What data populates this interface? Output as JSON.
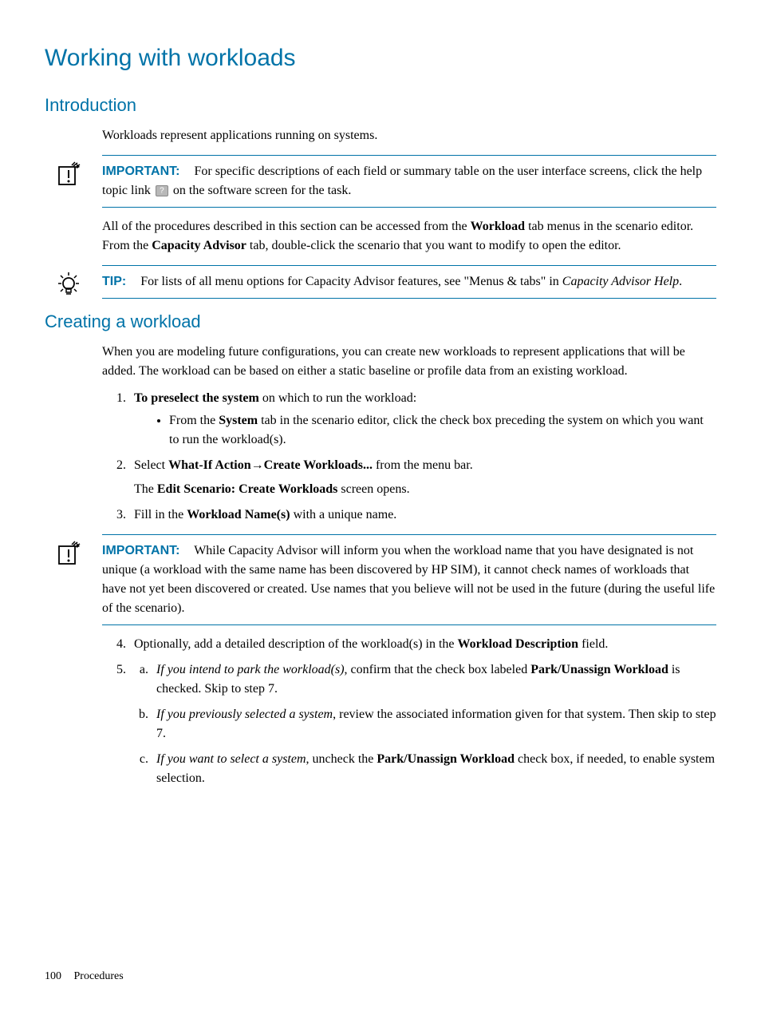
{
  "title": "Working with workloads",
  "section_intro": {
    "heading": "Introduction",
    "para1": "Workloads represent applications running on systems."
  },
  "callout1": {
    "label": "IMPORTANT:",
    "text_before": "For specific descriptions of each field or summary table on the user interface screens, click the help topic link ",
    "text_after": " on the software screen for the task."
  },
  "para_after_callout1_a": "All of the procedures described in this section can be accessed from the ",
  "para_after_callout1_b": "Workload",
  "para_after_callout1_c": " tab menus in the scenario editor. From the ",
  "para_after_callout1_d": "Capacity Advisor",
  "para_after_callout1_e": " tab, double-click the scenario that you want to modify to open the editor.",
  "callout2": {
    "label": "TIP:",
    "text_a": "For lists of all menu options for Capacity Advisor features, see \"Menus & tabs\" in ",
    "text_b": "Capacity Advisor Help",
    "text_c": "."
  },
  "section_create": {
    "heading": "Creating a workload",
    "intro": "When you are modeling future configurations, you can create new workloads to represent applications that will be added. The workload can be based on either a static baseline or profile data from an existing workload.",
    "step1_a": "To preselect the system",
    "step1_b": " on which to run the workload:",
    "step1_bullet_a": "From the ",
    "step1_bullet_b": "System",
    "step1_bullet_c": " tab in the scenario editor, click the check box preceding the system on which you want to run the workload(s).",
    "step2_a": "Select ",
    "step2_b": "What-If Action",
    "step2_arrow": "→",
    "step2_c": "Create Workloads...",
    "step2_d": " from the menu bar.",
    "step2_sub_a": "The ",
    "step2_sub_b": "Edit Scenario: Create Workloads",
    "step2_sub_c": " screen opens.",
    "step3_a": "Fill in the ",
    "step3_b": "Workload Name(s)",
    "step3_c": " with a unique name."
  },
  "callout3": {
    "label": "IMPORTANT:",
    "text": "While Capacity Advisor will inform you when the workload name that you have designated is not unique (a workload with the same name has been discovered by HP SIM), it cannot check names of workloads that have not yet been discovered or created. Use names that you believe will not be used in the future (during the useful life of the scenario)."
  },
  "steps_45": {
    "step4_a": "Optionally, add a detailed description of the workload(s) in the ",
    "step4_b": "Workload Description",
    "step4_c": " field.",
    "step5a_a": "If you intend to park the workload(s)",
    "step5a_b": ", confirm that the check box labeled ",
    "step5a_c": "Park/Unassign Workload",
    "step5a_d": " is checked. Skip to step 7.",
    "step5b_a": "If you previously selected a system",
    "step5b_b": ", review the associated information given for that system. Then skip to step 7.",
    "step5c_a": "If you want to select a system",
    "step5c_b": ", uncheck the ",
    "step5c_c": "Park/Unassign Workload",
    "step5c_d": " check box, if needed, to enable system selection."
  },
  "footer": {
    "page": "100",
    "label": "Procedures"
  }
}
